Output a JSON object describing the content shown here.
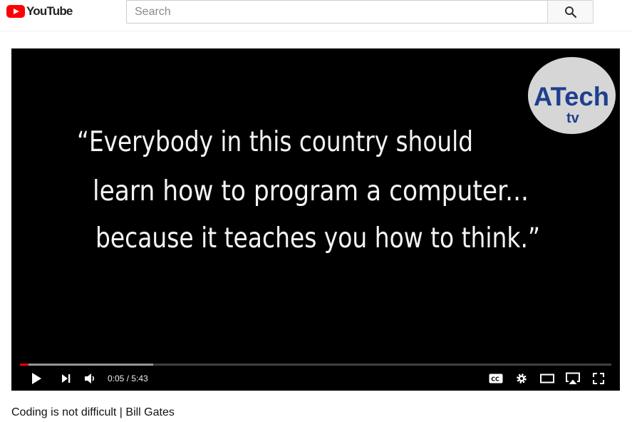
{
  "header": {
    "logo_text": "YouTube",
    "logo_icon": "youtube-play-icon",
    "search_placeholder": "Search",
    "search_value": "",
    "search_icon": "search-icon"
  },
  "video": {
    "quote_lines": [
      "“Everybody in this country should",
      "learn how to program a computer...",
      "because it teaches you how to think.”"
    ],
    "watermark": {
      "line1": "ATech",
      "line2": "tv"
    },
    "player": {
      "current_time": "0:05",
      "duration": "5:43",
      "time_display": "0:05 / 5:43",
      "played_fraction": 0.015,
      "buffered_fraction": 0.225,
      "icons": {
        "play": "play-icon",
        "next": "next-icon",
        "volume": "volume-icon",
        "captions": "captions-icon",
        "settings": "settings-gear-icon",
        "theater": "theater-mode-icon",
        "airplay": "airplay-icon",
        "fullscreen": "fullscreen-icon"
      }
    }
  },
  "title": "Coding is not difficult | Bill Gates",
  "colors": {
    "brand_red": "#ff0000",
    "player_bg": "#000000",
    "watermark_bg": "#d6d6d6",
    "watermark_blue": "#1d3f8e"
  }
}
